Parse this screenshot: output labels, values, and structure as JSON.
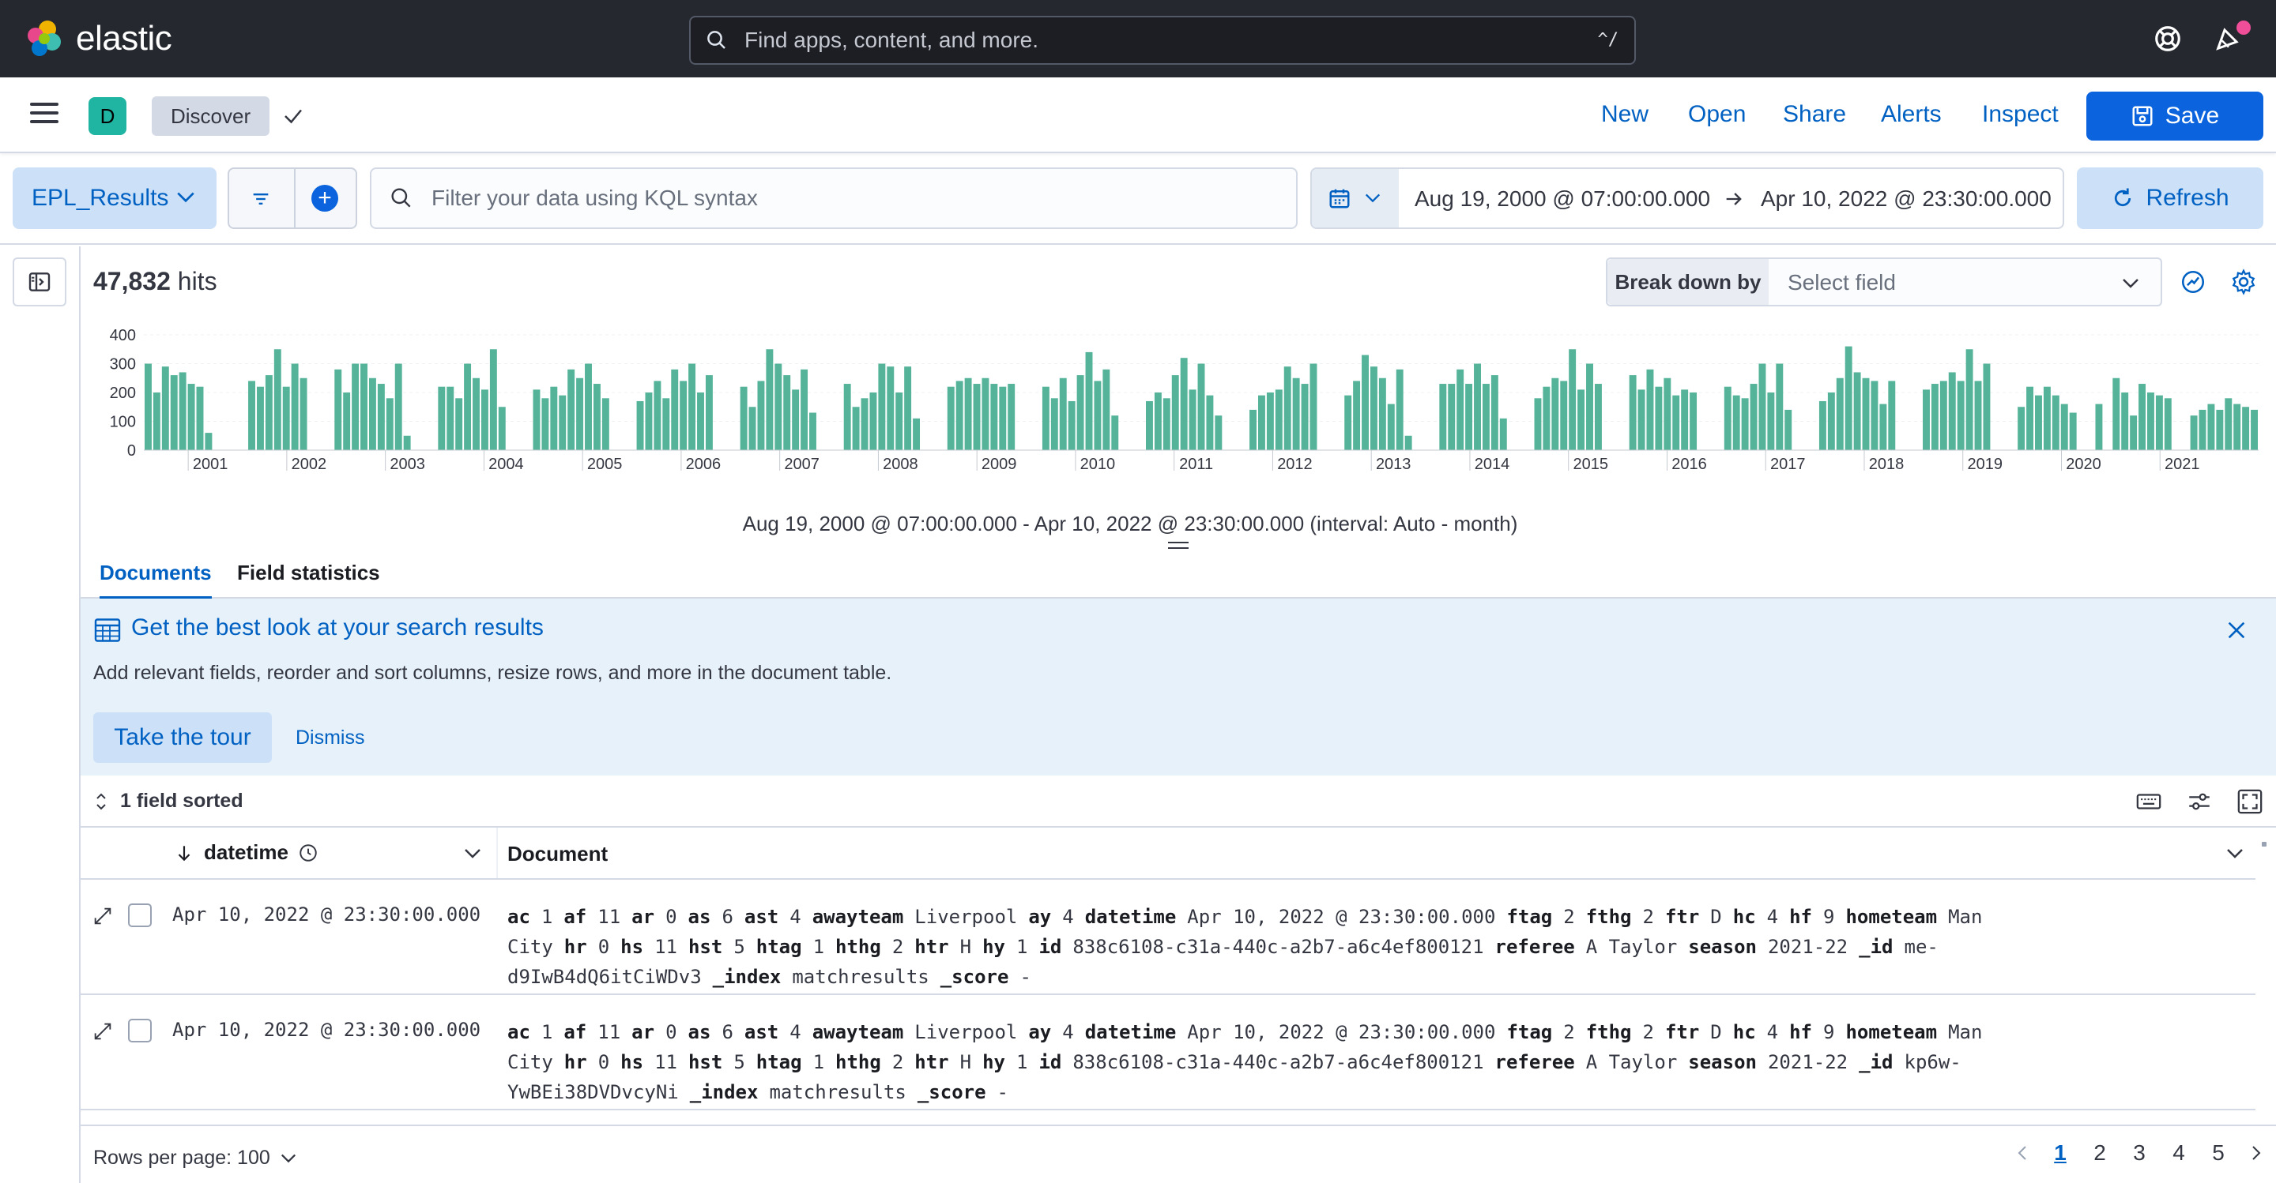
{
  "header": {
    "brand": "elastic",
    "search_placeholder": "Find apps, content, and more.",
    "search_shortcut": "^/"
  },
  "appbar": {
    "space_initial": "D",
    "breadcrumb": "Discover",
    "links": [
      "New",
      "Open",
      "Share",
      "Alerts",
      "Inspect"
    ],
    "save_label": "Save"
  },
  "querybar": {
    "data_view": "EPL_Results",
    "kql_placeholder": "Filter your data using KQL syntax",
    "start_date": "Aug 19, 2000 @ 07:00:00.000",
    "end_date": "Apr 10, 2022 @ 23:30:00.000",
    "refresh_label": "Refresh"
  },
  "results": {
    "hits_count": "47,832",
    "hits_label": "hits",
    "breakdown_label": "Break down by",
    "breakdown_placeholder": "Select field",
    "interval_text": "Aug 19, 2000 @ 07:00:00.000 - Apr 10, 2022 @ 23:30:00.000 (interval: Auto - month)"
  },
  "chart_data": {
    "type": "bar",
    "bar_color": "#54b399",
    "y_ticks": [
      "400",
      "300",
      "200",
      "100",
      "0"
    ],
    "ylim": [
      0,
      400
    ],
    "year_labels": [
      "2001",
      "2002",
      "2003",
      "2004",
      "2005",
      "2006",
      "2007",
      "2008",
      "2009",
      "2010",
      "2011",
      "2012",
      "2013",
      "2014",
      "2015",
      "2016",
      "2017",
      "2018",
      "2019",
      "2020",
      "2021"
    ],
    "values": [
      300,
      200,
      290,
      260,
      270,
      230,
      220,
      60,
      0,
      0,
      0,
      0,
      240,
      220,
      260,
      350,
      220,
      300,
      250,
      0,
      0,
      0,
      280,
      200,
      300,
      300,
      250,
      230,
      180,
      300,
      50,
      0,
      0,
      0,
      220,
      220,
      180,
      300,
      250,
      210,
      350,
      150,
      0,
      0,
      0,
      210,
      180,
      220,
      190,
      280,
      250,
      300,
      230,
      180,
      0,
      0,
      0,
      170,
      200,
      240,
      180,
      280,
      240,
      300,
      200,
      260,
      0,
      0,
      0,
      220,
      150,
      240,
      350,
      300,
      260,
      210,
      280,
      130,
      0,
      0,
      0,
      230,
      150,
      180,
      200,
      300,
      290,
      200,
      290,
      110,
      0,
      0,
      0,
      220,
      240,
      250,
      230,
      250,
      230,
      220,
      230,
      0,
      0,
      0,
      220,
      180,
      250,
      170,
      260,
      340,
      240,
      280,
      120,
      0,
      0,
      0,
      170,
      200,
      180,
      260,
      320,
      210,
      300,
      190,
      120,
      0,
      0,
      0,
      140,
      190,
      200,
      210,
      290,
      250,
      230,
      300,
      0,
      0,
      0,
      190,
      240,
      330,
      290,
      250,
      160,
      280,
      50,
      0,
      0,
      0,
      230,
      230,
      280,
      230,
      300,
      230,
      260,
      110,
      0,
      0,
      0,
      180,
      220,
      250,
      240,
      350,
      210,
      300,
      230,
      0,
      0,
      0,
      260,
      210,
      280,
      220,
      250,
      190,
      210,
      200,
      0,
      0,
      0,
      220,
      190,
      180,
      230,
      300,
      200,
      300,
      140,
      0,
      0,
      0,
      170,
      200,
      250,
      360,
      270,
      250,
      240,
      160,
      240,
      0,
      0,
      0,
      210,
      230,
      240,
      270,
      240,
      350,
      240,
      300,
      0,
      0,
      0,
      150,
      220,
      190,
      220,
      190,
      160,
      130,
      0,
      0,
      160,
      0,
      250,
      200,
      120,
      230,
      200,
      190,
      180,
      0,
      0,
      120,
      140,
      160,
      140,
      180,
      160,
      150,
      140
    ],
    "xlabel": "",
    "ylabel": ""
  },
  "tabs": [
    "Documents",
    "Field statistics"
  ],
  "callout": {
    "title": "Get the best look at your search results",
    "text": "Add relevant fields, reorder and sort columns, resize rows, and more in the document table.",
    "tour_label": "Take the tour",
    "dismiss_label": "Dismiss"
  },
  "grid": {
    "sorted_label": "1 field sorted",
    "col_datetime": "datetime",
    "col_document": "Document",
    "rows": [
      {
        "datetime": "Apr 10, 2022 @ 23:30:00.000",
        "fields": [
          [
            "ac",
            "1"
          ],
          [
            "af",
            "11"
          ],
          [
            "ar",
            "0"
          ],
          [
            "as",
            "6"
          ],
          [
            "ast",
            "4"
          ],
          [
            "awayteam",
            "Liverpool"
          ],
          [
            "ay",
            "4"
          ],
          [
            "datetime",
            "Apr 10, 2022 @ 23:30:00.000"
          ],
          [
            "ftag",
            "2"
          ],
          [
            "fthg",
            "2"
          ],
          [
            "ftr",
            "D"
          ],
          [
            "hc",
            "4"
          ],
          [
            "hf",
            "9"
          ],
          [
            "hometeam",
            "Man City"
          ],
          [
            "hr",
            "0"
          ],
          [
            "hs",
            "11"
          ],
          [
            "hst",
            "5"
          ],
          [
            "htag",
            "1"
          ],
          [
            "hthg",
            "2"
          ],
          [
            "htr",
            "H"
          ],
          [
            "hy",
            "1"
          ],
          [
            "id",
            "838c6108-c31a-440c-a2b7-a6c4ef800121"
          ],
          [
            "referee",
            "A Taylor"
          ],
          [
            "season",
            "2021-22"
          ],
          [
            "_id",
            "me-d9IwB4dQ6itCiWDv3"
          ],
          [
            "_index",
            "matchresults"
          ],
          [
            "_score",
            "-"
          ]
        ]
      },
      {
        "datetime": "Apr 10, 2022 @ 23:30:00.000",
        "fields": [
          [
            "ac",
            "1"
          ],
          [
            "af",
            "11"
          ],
          [
            "ar",
            "0"
          ],
          [
            "as",
            "6"
          ],
          [
            "ast",
            "4"
          ],
          [
            "awayteam",
            "Liverpool"
          ],
          [
            "ay",
            "4"
          ],
          [
            "datetime",
            "Apr 10, 2022 @ 23:30:00.000"
          ],
          [
            "ftag",
            "2"
          ],
          [
            "fthg",
            "2"
          ],
          [
            "ftr",
            "D"
          ],
          [
            "hc",
            "4"
          ],
          [
            "hf",
            "9"
          ],
          [
            "hometeam",
            "Man City"
          ],
          [
            "hr",
            "0"
          ],
          [
            "hs",
            "11"
          ],
          [
            "hst",
            "5"
          ],
          [
            "htag",
            "1"
          ],
          [
            "hthg",
            "2"
          ],
          [
            "htr",
            "H"
          ],
          [
            "hy",
            "1"
          ],
          [
            "id",
            "838c6108-c31a-440c-a2b7-a6c4ef800121"
          ],
          [
            "referee",
            "A Taylor"
          ],
          [
            "season",
            "2021-22"
          ],
          [
            "_id",
            "kp6w-YwBEi38DVDvcyNi"
          ],
          [
            "_index",
            "matchresults"
          ],
          [
            "_score",
            "-"
          ]
        ]
      }
    ]
  },
  "footer": {
    "rows_per_page": "Rows per page: 100",
    "pages": [
      "1",
      "2",
      "3",
      "4",
      "5"
    ],
    "active_page": "1"
  }
}
